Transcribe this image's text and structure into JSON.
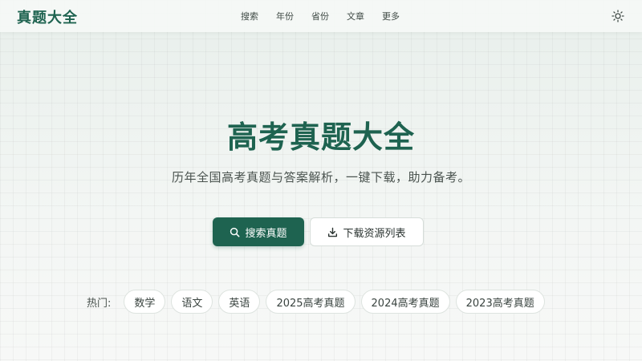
{
  "header": {
    "brand": "真题大全",
    "nav": [
      "搜索",
      "年份",
      "省份",
      "文章",
      "更多"
    ],
    "theme_icon": "sun-icon"
  },
  "hero": {
    "title": "高考真题大全",
    "subtitle": "历年全国高考真题与答案解析，一键下载，助力备考。"
  },
  "actions": {
    "search_label": "搜索真题",
    "search_icon": "search-icon",
    "download_label": "下载资源列表",
    "download_icon": "download-icon"
  },
  "hot": {
    "label": "热门:",
    "tags": [
      "数学",
      "语文",
      "英语",
      "2025高考真题",
      "2024高考真题",
      "2023高考真题"
    ]
  },
  "colors": {
    "brand": "#1e6350",
    "background": "#eff4f1",
    "chip_background": "#ffffff"
  }
}
